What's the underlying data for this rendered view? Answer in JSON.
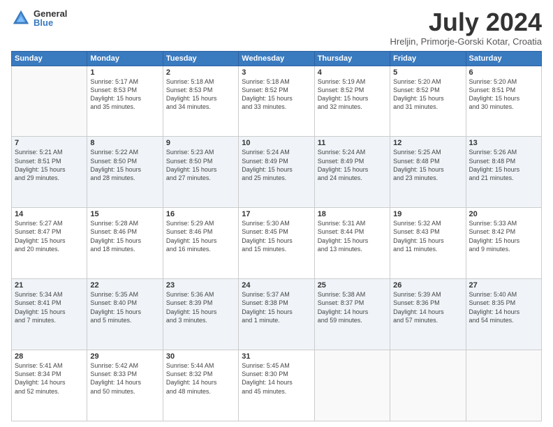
{
  "logo": {
    "general": "General",
    "blue": "Blue"
  },
  "title": "July 2024",
  "location": "Hreljin, Primorje-Gorski Kotar, Croatia",
  "days_of_week": [
    "Sunday",
    "Monday",
    "Tuesday",
    "Wednesday",
    "Thursday",
    "Friday",
    "Saturday"
  ],
  "weeks": [
    [
      {
        "day": "",
        "info": ""
      },
      {
        "day": "1",
        "info": "Sunrise: 5:17 AM\nSunset: 8:53 PM\nDaylight: 15 hours\nand 35 minutes."
      },
      {
        "day": "2",
        "info": "Sunrise: 5:18 AM\nSunset: 8:53 PM\nDaylight: 15 hours\nand 34 minutes."
      },
      {
        "day": "3",
        "info": "Sunrise: 5:18 AM\nSunset: 8:52 PM\nDaylight: 15 hours\nand 33 minutes."
      },
      {
        "day": "4",
        "info": "Sunrise: 5:19 AM\nSunset: 8:52 PM\nDaylight: 15 hours\nand 32 minutes."
      },
      {
        "day": "5",
        "info": "Sunrise: 5:20 AM\nSunset: 8:52 PM\nDaylight: 15 hours\nand 31 minutes."
      },
      {
        "day": "6",
        "info": "Sunrise: 5:20 AM\nSunset: 8:51 PM\nDaylight: 15 hours\nand 30 minutes."
      }
    ],
    [
      {
        "day": "7",
        "info": "Sunrise: 5:21 AM\nSunset: 8:51 PM\nDaylight: 15 hours\nand 29 minutes."
      },
      {
        "day": "8",
        "info": "Sunrise: 5:22 AM\nSunset: 8:50 PM\nDaylight: 15 hours\nand 28 minutes."
      },
      {
        "day": "9",
        "info": "Sunrise: 5:23 AM\nSunset: 8:50 PM\nDaylight: 15 hours\nand 27 minutes."
      },
      {
        "day": "10",
        "info": "Sunrise: 5:24 AM\nSunset: 8:49 PM\nDaylight: 15 hours\nand 25 minutes."
      },
      {
        "day": "11",
        "info": "Sunrise: 5:24 AM\nSunset: 8:49 PM\nDaylight: 15 hours\nand 24 minutes."
      },
      {
        "day": "12",
        "info": "Sunrise: 5:25 AM\nSunset: 8:48 PM\nDaylight: 15 hours\nand 23 minutes."
      },
      {
        "day": "13",
        "info": "Sunrise: 5:26 AM\nSunset: 8:48 PM\nDaylight: 15 hours\nand 21 minutes."
      }
    ],
    [
      {
        "day": "14",
        "info": "Sunrise: 5:27 AM\nSunset: 8:47 PM\nDaylight: 15 hours\nand 20 minutes."
      },
      {
        "day": "15",
        "info": "Sunrise: 5:28 AM\nSunset: 8:46 PM\nDaylight: 15 hours\nand 18 minutes."
      },
      {
        "day": "16",
        "info": "Sunrise: 5:29 AM\nSunset: 8:46 PM\nDaylight: 15 hours\nand 16 minutes."
      },
      {
        "day": "17",
        "info": "Sunrise: 5:30 AM\nSunset: 8:45 PM\nDaylight: 15 hours\nand 15 minutes."
      },
      {
        "day": "18",
        "info": "Sunrise: 5:31 AM\nSunset: 8:44 PM\nDaylight: 15 hours\nand 13 minutes."
      },
      {
        "day": "19",
        "info": "Sunrise: 5:32 AM\nSunset: 8:43 PM\nDaylight: 15 hours\nand 11 minutes."
      },
      {
        "day": "20",
        "info": "Sunrise: 5:33 AM\nSunset: 8:42 PM\nDaylight: 15 hours\nand 9 minutes."
      }
    ],
    [
      {
        "day": "21",
        "info": "Sunrise: 5:34 AM\nSunset: 8:41 PM\nDaylight: 15 hours\nand 7 minutes."
      },
      {
        "day": "22",
        "info": "Sunrise: 5:35 AM\nSunset: 8:40 PM\nDaylight: 15 hours\nand 5 minutes."
      },
      {
        "day": "23",
        "info": "Sunrise: 5:36 AM\nSunset: 8:39 PM\nDaylight: 15 hours\nand 3 minutes."
      },
      {
        "day": "24",
        "info": "Sunrise: 5:37 AM\nSunset: 8:38 PM\nDaylight: 15 hours\nand 1 minute."
      },
      {
        "day": "25",
        "info": "Sunrise: 5:38 AM\nSunset: 8:37 PM\nDaylight: 14 hours\nand 59 minutes."
      },
      {
        "day": "26",
        "info": "Sunrise: 5:39 AM\nSunset: 8:36 PM\nDaylight: 14 hours\nand 57 minutes."
      },
      {
        "day": "27",
        "info": "Sunrise: 5:40 AM\nSunset: 8:35 PM\nDaylight: 14 hours\nand 54 minutes."
      }
    ],
    [
      {
        "day": "28",
        "info": "Sunrise: 5:41 AM\nSunset: 8:34 PM\nDaylight: 14 hours\nand 52 minutes."
      },
      {
        "day": "29",
        "info": "Sunrise: 5:42 AM\nSunset: 8:33 PM\nDaylight: 14 hours\nand 50 minutes."
      },
      {
        "day": "30",
        "info": "Sunrise: 5:44 AM\nSunset: 8:32 PM\nDaylight: 14 hours\nand 48 minutes."
      },
      {
        "day": "31",
        "info": "Sunrise: 5:45 AM\nSunset: 8:30 PM\nDaylight: 14 hours\nand 45 minutes."
      },
      {
        "day": "",
        "info": ""
      },
      {
        "day": "",
        "info": ""
      },
      {
        "day": "",
        "info": ""
      }
    ]
  ]
}
